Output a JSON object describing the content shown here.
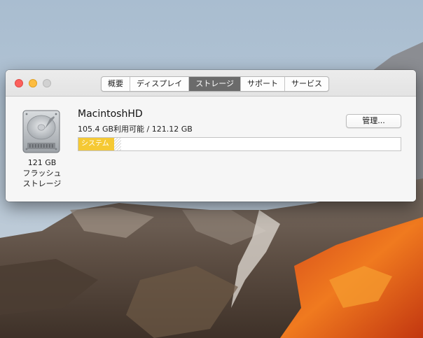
{
  "window": {
    "tabs": [
      {
        "label": "概要"
      },
      {
        "label": "ディスプレイ"
      },
      {
        "label": "ストレージ",
        "active": true
      },
      {
        "label": "サポート"
      },
      {
        "label": "サービス"
      }
    ]
  },
  "disk": {
    "caption_lines": [
      "121 GB",
      "フラッシュ",
      "ストレージ"
    ]
  },
  "volume": {
    "name": "MacintoshHD",
    "info": "105.4 GB利用可能 / 121.12 GB",
    "manage_label": "管理..."
  },
  "storage_bar": {
    "segments": [
      {
        "label": "システム",
        "fraction": 0.11,
        "color": "#f5c934"
      },
      {
        "label": "",
        "fraction": 0.02,
        "color": "#d9d9d9"
      }
    ]
  },
  "colors": {
    "system_segment": "#f5c934",
    "close": "#fc605c",
    "minimize": "#fdbc40",
    "zoom_disabled": "#d1d1d1",
    "active_tab": "#6b6b6b"
  },
  "icons": {
    "disk": "hard-drive-icon"
  }
}
